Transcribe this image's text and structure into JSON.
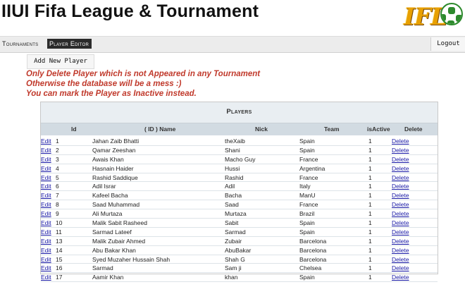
{
  "header": {
    "title": "IIUI Fifa League & Tournament",
    "logo_text": "IFL"
  },
  "nav": {
    "tournaments": "Tournaments",
    "player_editor": "Player Editor",
    "logout": "Logout"
  },
  "add_button": "Add New Player",
  "warnings": [
    "Only Delete Player which is not Appeared in any Tournament",
    "Otherwise the database will be a mess :)",
    "You can mark the Player as Inactive instead."
  ],
  "table": {
    "caption": "Players",
    "headers": {
      "id": "Id",
      "name": "( ID ) Name",
      "nick": "Nick",
      "team": "Team",
      "active": "isActive",
      "delete": "Delete"
    },
    "edit_label": "Edit",
    "delete_label": "Delete",
    "rows": [
      {
        "id": "1",
        "name": "Jahan Zaib Bhatti",
        "nick": "theXaib",
        "team": "Spain",
        "active": "1"
      },
      {
        "id": "2",
        "name": "Qamar Zeeshan",
        "nick": "Shani",
        "team": "Spain",
        "active": "1"
      },
      {
        "id": "3",
        "name": "Awais Khan",
        "nick": "Macho Guy",
        "team": "France",
        "active": "1"
      },
      {
        "id": "4",
        "name": "Hasnain Haider",
        "nick": "Hussi",
        "team": "Argentina",
        "active": "1"
      },
      {
        "id": "5",
        "name": "Rashid Saddique",
        "nick": "Rashid",
        "team": "France",
        "active": "1"
      },
      {
        "id": "6",
        "name": "Adil Israr",
        "nick": "Adil",
        "team": "Italy",
        "active": "1"
      },
      {
        "id": "7",
        "name": "Kafeel Bacha",
        "nick": "Bacha",
        "team": "ManU",
        "active": "1"
      },
      {
        "id": "8",
        "name": "Saad Muhammad",
        "nick": "Saad",
        "team": "France",
        "active": "1"
      },
      {
        "id": "9",
        "name": "Ali Murtaza",
        "nick": "Murtaza",
        "team": "Brazil",
        "active": "1"
      },
      {
        "id": "10",
        "name": "Malik Sabit Rasheed",
        "nick": "Sabit",
        "team": "Spain",
        "active": "1"
      },
      {
        "id": "11",
        "name": "Sarmad Lateef",
        "nick": "Sarmad",
        "team": "Spain",
        "active": "1"
      },
      {
        "id": "13",
        "name": "Malik Zubair Ahmed",
        "nick": "Zubair",
        "team": "Barcelona",
        "active": "1"
      },
      {
        "id": "14",
        "name": "Abu Bakar Khan",
        "nick": "AbuBakar",
        "team": "Barcelona",
        "active": "1"
      },
      {
        "id": "15",
        "name": "Syed Muzaher Hussain Shah",
        "nick": "Shah G",
        "team": "Barcelona",
        "active": "1"
      },
      {
        "id": "16",
        "name": "Sarmad",
        "nick": "Sam ji",
        "team": "Chelsea",
        "active": "1"
      },
      {
        "id": "17",
        "name": "Aamir Khan",
        "nick": "khan",
        "team": "Spain",
        "active": "1"
      }
    ]
  },
  "colors": {
    "warning": "#c0392b",
    "link": "#1a1aa6",
    "nav_active_bg": "#2b2b2b",
    "table_header_bg": "#d2dbe2"
  }
}
